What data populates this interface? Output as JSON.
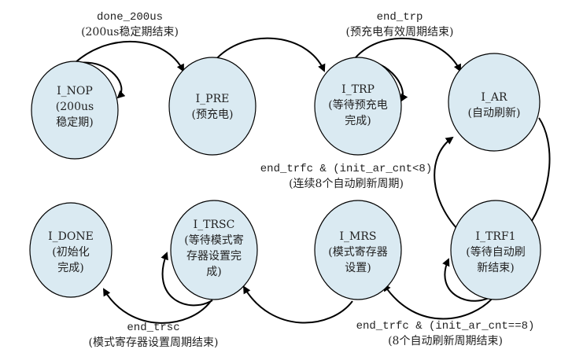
{
  "nodes": {
    "nop": {
      "name": "I_NOP",
      "desc": [
        "(200us",
        "稳定期)"
      ]
    },
    "pre": {
      "name": "I_PRE",
      "desc": [
        "(预充电)"
      ]
    },
    "trp": {
      "name": "I_TRP",
      "desc": [
        "(等待预充电",
        "完成)"
      ]
    },
    "ar": {
      "name": "I_AR",
      "desc": [
        "(自动刷新)"
      ]
    },
    "done": {
      "name": "I_DONE",
      "desc": [
        "(初始化",
        "完成)"
      ]
    },
    "trsc": {
      "name": "I_TRSC",
      "desc": [
        "(等待模式寄",
        "存器设置完",
        "成)"
      ]
    },
    "mrs": {
      "name": "I_MRS",
      "desc": [
        "(模式寄存器",
        "设置)"
      ]
    },
    "trf1": {
      "name": "I_TRF1",
      "desc": [
        "(等待自动刷",
        "新结束)"
      ]
    }
  },
  "edges": {
    "nop_pre": {
      "cond": "done_200us",
      "desc": "(200us稳定期结束)"
    },
    "trp_ar": {
      "cond": "end_trp",
      "desc": "(预充电有效周期结束)"
    },
    "trf1_ar": {
      "cond": "end_trfc & (init_ar_cnt<8)",
      "desc": "(连续8个自动刷新周期)"
    },
    "trsc_done": {
      "cond": "end_trsc",
      "desc": "(模式寄存器设置周期结束)"
    },
    "trf1_mrs": {
      "cond": "end_trfc & (init_ar_cnt==8)",
      "desc": "(8个自动刷新周期结束)"
    }
  },
  "colors": {
    "node_fill": "#daeaf2",
    "stroke": "#000000"
  }
}
